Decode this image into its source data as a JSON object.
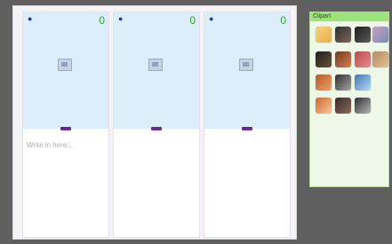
{
  "panels": [
    {
      "pin": "●",
      "count": "0",
      "has_text": true
    },
    {
      "pin": "●",
      "count": "0",
      "has_text": false
    },
    {
      "pin": "●",
      "count": "0",
      "has_text": false
    }
  ],
  "write_placeholder": "Write in here...",
  "sidepanel": {
    "title": "Clipart"
  },
  "clipart": [
    "clipart-person-1",
    "clipart-person-2",
    "clipart-person-3",
    "clipart-person-4",
    "clipart-person-5",
    "clipart-person-6",
    "clipart-person-7",
    "clipart-person-8",
    "clipart-computer",
    "clipart-people-1",
    "clipart-people-2",
    "clipart-people-3",
    "clipart-people-4",
    "clipart-flower"
  ]
}
